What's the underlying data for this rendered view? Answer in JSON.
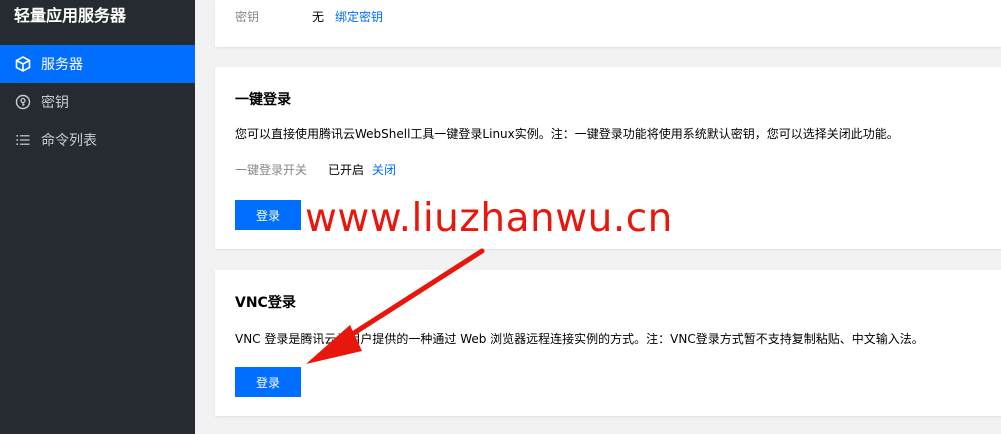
{
  "sidebar": {
    "title": "轻量应用服务器",
    "items": [
      {
        "label": "服务器",
        "icon": "cube-icon",
        "active": true
      },
      {
        "label": "密钥",
        "icon": "key-circle-icon",
        "active": false
      },
      {
        "label": "命令列表",
        "icon": "list-icon",
        "active": false
      }
    ]
  },
  "key_card": {
    "label": "密钥",
    "value": "无",
    "link": "绑定密钥"
  },
  "webshell_card": {
    "title": "一键登录",
    "description": "您可以直接使用腾讯云WebShell工具一键登录Linux实例。注：一键登录功能将使用系统默认密钥，您可以选择关闭此功能。",
    "switch_label": "一键登录开关",
    "switch_value": "已开启",
    "switch_link": "关闭",
    "login_button": "登录"
  },
  "vnc_card": {
    "title": "VNC登录",
    "description": "VNC 登录是腾讯云为用户提供的一种通过 Web 浏览器远程连接实例的方式。注：VNC登录方式暂不支持复制粘贴、中文输入法。",
    "login_button": "登录"
  },
  "watermark": "www.liuzhanwu.cn",
  "colors": {
    "sidebar_bg": "#262b31",
    "accent": "#006eff",
    "watermark": "#e8170e"
  }
}
